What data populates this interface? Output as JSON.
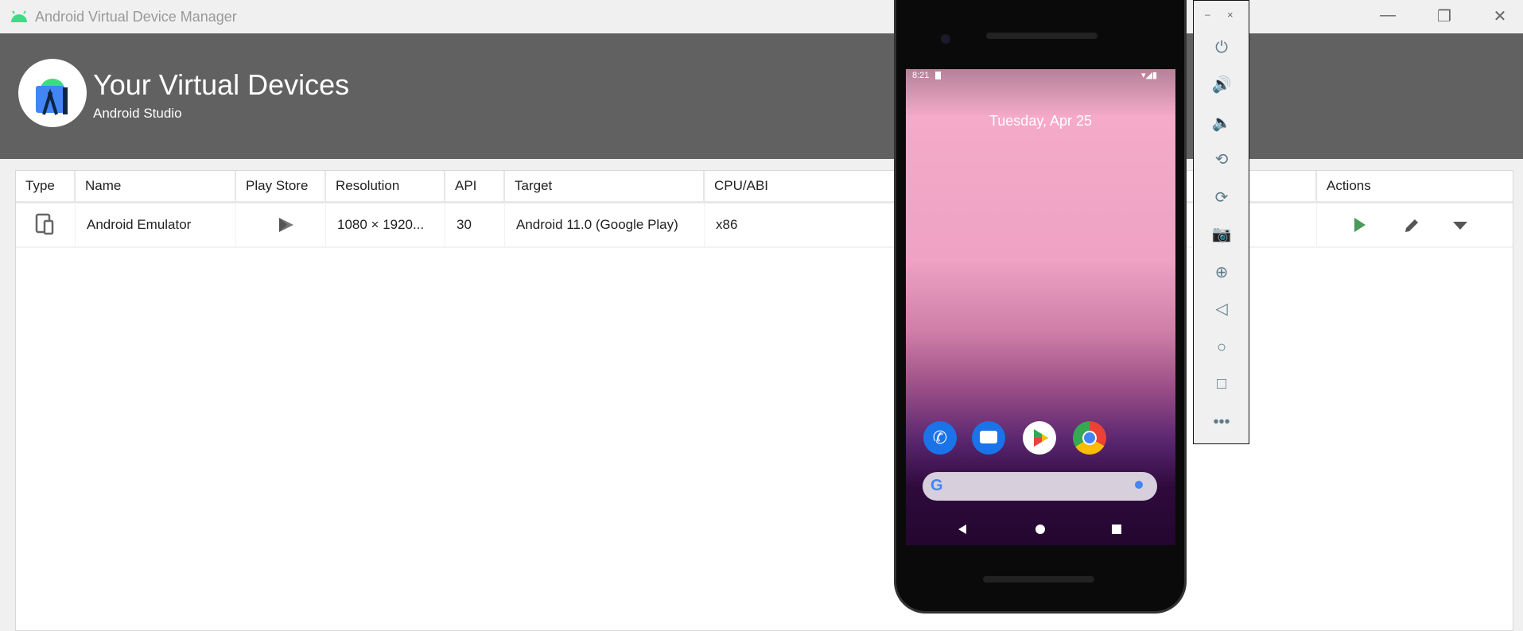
{
  "window": {
    "title": "Android Virtual Device Manager",
    "icon": "android-icon",
    "controls": [
      "minimize-icon",
      "restore-icon",
      "close-icon"
    ]
  },
  "banner": {
    "title": "Your Virtual Devices",
    "subtitle": "Android Studio",
    "logo": "android-studio-logo"
  },
  "table": {
    "columns": [
      "Type",
      "Name",
      "Play Store",
      "Resolution",
      "API",
      "Target",
      "CPU/ABI",
      "Actions"
    ],
    "rows": [
      {
        "type_icon": "phone-tablet-icon",
        "name": "Android Emulator",
        "play_store_icon": "play-store-icon",
        "resolution": "1080 × 1920...",
        "api": "30",
        "target": "Android 11.0 (Google Play)",
        "cpu": "x86",
        "actions": [
          "launch-icon",
          "edit-icon",
          "more-dropdown-icon"
        ]
      }
    ]
  },
  "emulator": {
    "status_time": "8:21",
    "date": "Tuesday, Apr 25",
    "apps": [
      "phone-app",
      "messages-app",
      "play-store-app",
      "chrome-app"
    ],
    "toolbar": {
      "minimize": "–",
      "close": "×",
      "buttons": [
        "power-icon",
        "volume-up-icon",
        "volume-down-icon",
        "rotate-left-icon",
        "rotate-right-icon",
        "screenshot-icon",
        "zoom-icon",
        "back-icon",
        "home-icon",
        "overview-icon",
        "more-icon"
      ]
    },
    "accent": "#4a9a5a"
  }
}
